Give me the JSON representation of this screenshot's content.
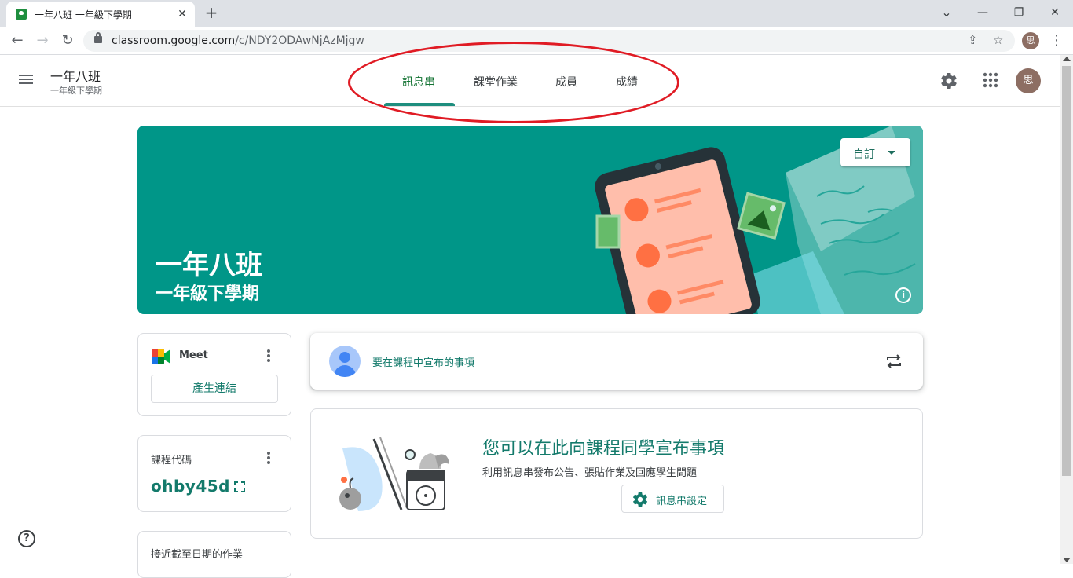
{
  "browser": {
    "tab_title": "一年八班 一年級下學期",
    "tab_close": "✕",
    "new_tab": "+",
    "url_host": "classroom.google.com",
    "url_path": "/c/NDY2ODAwNjAzMjgw",
    "profile_initial": "思",
    "window_minimize": "—",
    "window_restore": "❐",
    "window_close": "✕"
  },
  "header": {
    "class_name": "一年八班",
    "section": "一年級下學期",
    "tabs": [
      {
        "label": "訊息串",
        "active": true
      },
      {
        "label": "課堂作業",
        "active": false
      },
      {
        "label": "成員",
        "active": false
      },
      {
        "label": "成績",
        "active": false
      }
    ],
    "avatar_initial": "思"
  },
  "banner": {
    "title": "一年八班",
    "subtitle": "一年級下學期",
    "customize_label": "自訂",
    "info": "i",
    "color": "#009688"
  },
  "meet": {
    "label": "Meet",
    "button": "產生連結"
  },
  "class_code": {
    "label": "課程代碼",
    "value": "ohby45d"
  },
  "upcoming": {
    "label": "接近截至日期的作業"
  },
  "announce": {
    "placeholder": "要在課程中宣布的事項"
  },
  "empty_state": {
    "title": "您可以在此向課程同學宣布事項",
    "subtitle": "利用訊息串發布公告、張貼作業及回應學生問題",
    "button": "訊息串設定"
  },
  "help": "?",
  "accent_color": "#137a6b"
}
